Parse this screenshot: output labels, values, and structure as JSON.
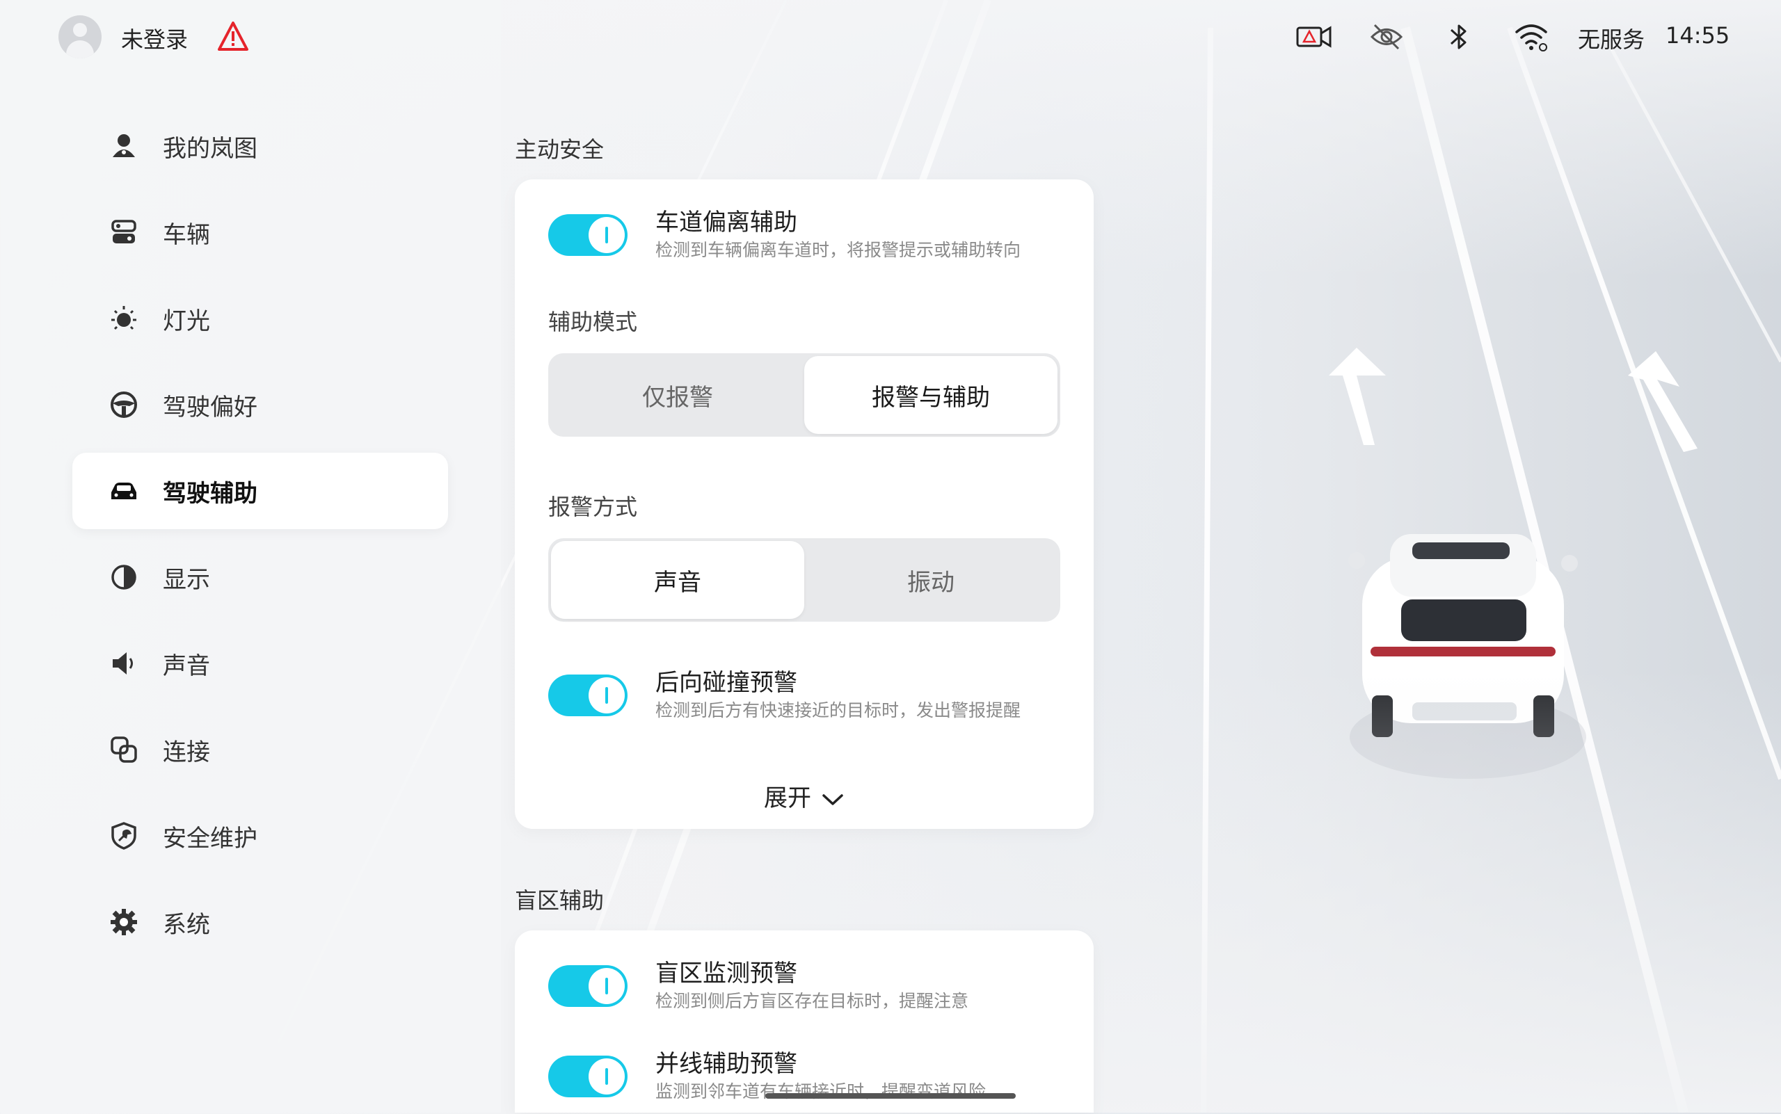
{
  "status_bar": {
    "login_text": "未登录",
    "network_text": "无服务",
    "time": "14:55",
    "icons": [
      "avatar-icon",
      "warning-triangle-icon",
      "camera-warning-icon",
      "eye-off-icon",
      "bluetooth-icon",
      "wifi-icon"
    ]
  },
  "sidebar": {
    "items": [
      {
        "label": "我的岚图",
        "icon": "user-pin-icon"
      },
      {
        "label": "车辆",
        "icon": "vehicle-control-icon"
      },
      {
        "label": "灯光",
        "icon": "light-icon"
      },
      {
        "label": "驾驶偏好",
        "icon": "steering-wheel-icon"
      },
      {
        "label": "驾驶辅助",
        "icon": "car-icon",
        "active": true
      },
      {
        "label": "显示",
        "icon": "contrast-icon"
      },
      {
        "label": "声音",
        "icon": "speaker-icon"
      },
      {
        "label": "连接",
        "icon": "connection-icon"
      },
      {
        "label": "安全维护",
        "icon": "shield-wrench-icon"
      },
      {
        "label": "系统",
        "icon": "gear-icon"
      }
    ]
  },
  "active_safety": {
    "title": "主动安全",
    "lane_departure": {
      "title": "车道偏离辅助",
      "desc": "检测到车辆偏离车道时，将报警提示或辅助转向",
      "enabled": true
    },
    "assist_mode": {
      "label": "辅助模式",
      "options": [
        "仅报警",
        "报警与辅助"
      ],
      "selected": "报警与辅助"
    },
    "alert_method": {
      "label": "报警方式",
      "options": [
        "声音",
        "振动"
      ],
      "selected": "声音"
    },
    "rear_collision": {
      "title": "后向碰撞预警",
      "desc": "检测到后方有快速接近的目标时，发出警报提醒",
      "enabled": true
    },
    "expand_label": "展开"
  },
  "blind_spot": {
    "title": "盲区辅助",
    "monitor": {
      "title": "盲区监测预警",
      "desc": "检测到侧后方盲区存在目标时，提醒注意",
      "enabled": true
    },
    "lane_change": {
      "title": "并线辅助预警",
      "desc": "监测到邻车道有车辆接近时，提醒变道风险",
      "enabled": true
    }
  },
  "colors": {
    "accent": "#16c9e8",
    "warning": "#e5242b",
    "card": "#ffffff"
  }
}
